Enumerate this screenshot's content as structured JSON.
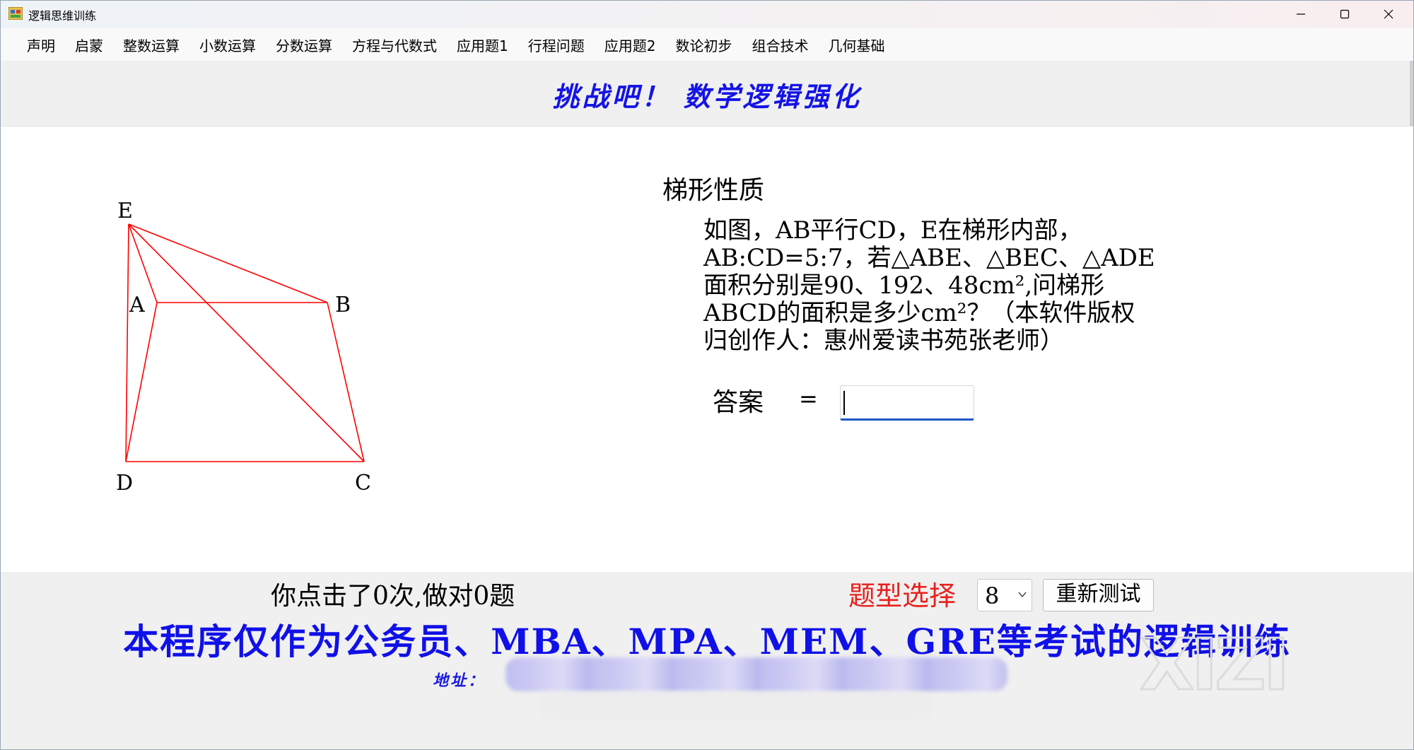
{
  "window": {
    "title": "逻辑思维训练",
    "controls": [
      "minimize-icon",
      "maximize-icon",
      "close-icon"
    ]
  },
  "menu": {
    "items": [
      {
        "label": "声明"
      },
      {
        "label": "启蒙"
      },
      {
        "label": "整数运算"
      },
      {
        "label": "小数运算"
      },
      {
        "label": "分数运算"
      },
      {
        "label": "方程与代数式"
      },
      {
        "label": "应用题1"
      },
      {
        "label": "行程问题"
      },
      {
        "label": "应用题2"
      },
      {
        "label": "数论初步"
      },
      {
        "label": "组合技术"
      },
      {
        "label": "几何基础"
      }
    ]
  },
  "header": {
    "banner": "挑战吧！ 数学逻辑强化"
  },
  "diagram": {
    "labels": {
      "E": "E",
      "A": "A",
      "B": "B",
      "D": "D",
      "C": "C"
    },
    "line_color": "#ff0000"
  },
  "problem": {
    "title": "梯形性质",
    "text": "如图，AB平行CD，E在梯形内部，AB:CD=5:7，若△ABE、△BEC、△ADE面积分别是90、192、48cm²,问梯形ABCD的面积是多少cm²？（本软件版权归创作人：惠州爱读书苑张老师）"
  },
  "answer": {
    "label": "答案",
    "equals": "=",
    "value": ""
  },
  "status": {
    "click_text": "你点击了0次,做对0题"
  },
  "controls": {
    "type_label": "题型选择",
    "type_value": "8",
    "retest_label": "重新测试"
  },
  "footer": {
    "banner": "本程序仅作为公务员、MBA、MPA、MEM、GRE等考试的逻辑训练",
    "address_label": "地址：",
    "watermark": "XIZI"
  },
  "colors": {
    "banner_blue": "#1414e6",
    "type_red": "#e8201c",
    "input_accent": "#1f56c8"
  }
}
